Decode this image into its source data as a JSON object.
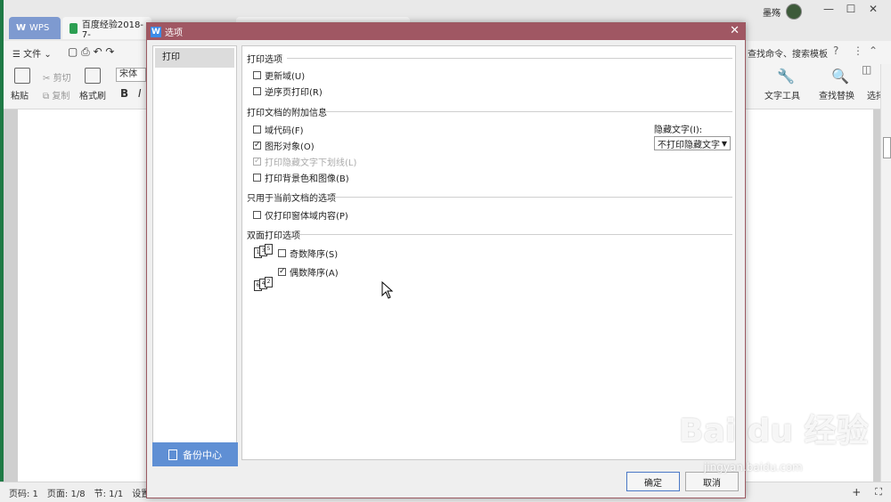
{
  "app": {
    "tabs": [
      {
        "label": "WPS"
      },
      {
        "label": "百度经验2018-7-"
      }
    ],
    "user_name": "墨殇",
    "window_controls": [
      "minimize",
      "restore",
      "close"
    ]
  },
  "toolbar": {
    "file_menu": "文件",
    "paste": "粘贴",
    "cut": "剪切",
    "copy": "复制",
    "format_painter": "格式刷",
    "font_name": "宋体",
    "bold": "B",
    "italic": "I",
    "search_hint": "查找命令、搜索模板",
    "text_tools": "文字工具",
    "find_replace": "查找替换",
    "select": "选择"
  },
  "status": {
    "page_code": "页码: 1",
    "page": "页面: 1/8",
    "section": "节: 1/1",
    "settings": "设置"
  },
  "dialog": {
    "title": "选项",
    "nav": [
      {
        "label": "打印"
      }
    ],
    "backup_label": "备份中心",
    "sections": {
      "print_options": "打印选项",
      "print_extra": "打印文档的附加信息",
      "current_doc": "只用于当前文档的选项",
      "duplex": "双面打印选项"
    },
    "options": {
      "update_fields": {
        "label": "更新域(U)",
        "checked": false
      },
      "reverse_order": {
        "label": "逆序页打印(R)",
        "checked": false
      },
      "field_codes": {
        "label": "域代码(F)",
        "checked": false
      },
      "graphic_objects": {
        "label": "图形对象(O)",
        "checked": true
      },
      "hidden_underline": {
        "label": "打印隐藏文字下划线(L)",
        "checked": true,
        "disabled": true
      },
      "background": {
        "label": "打印背景色和图像(B)",
        "checked": false
      },
      "form_only": {
        "label": "仅打印窗体域内容(P)",
        "checked": false
      },
      "odd_reverse": {
        "label": "奇数降序(S)",
        "checked": false
      },
      "even_reverse": {
        "label": "偶数降序(A)",
        "checked": true
      }
    },
    "hidden_text_label": "隐藏文字(I):",
    "hidden_text_value": "不打印隐藏文字",
    "ok_label": "确定",
    "cancel_label": "取消"
  },
  "watermark": {
    "brand": "Bai du 经验",
    "url": "jingyan.baidu.com"
  },
  "colors": {
    "dialog_title": "#a05763",
    "backup_button": "#5f8fd4",
    "wps_tab": "#7e9ad0"
  }
}
